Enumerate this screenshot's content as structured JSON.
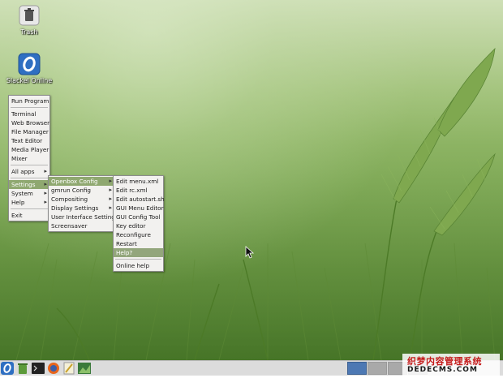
{
  "desktop_icons": [
    {
      "label": "Trash",
      "icon": "trash-icon"
    },
    {
      "label": "Slackel Online",
      "icon": "slackel-online-icon"
    }
  ],
  "root_menu": {
    "items": [
      "Run Program",
      "Terminal",
      "Web Browser",
      "File Manager",
      "Text Editor",
      "Media Player",
      "Mixer",
      "All apps",
      "Settings",
      "System",
      "Help",
      "Exit"
    ],
    "active": "Settings"
  },
  "settings_menu": {
    "items": [
      "Openbox Config",
      "gmrun Config",
      "Compositing",
      "Display Settings",
      "User Interface Settings",
      "Screensaver"
    ],
    "active": "Openbox Config"
  },
  "openbox_menu": {
    "items": [
      "Edit menu.xml",
      "Edit rc.xml",
      "Edit autostart.sh",
      "GUI Menu Editor",
      "GUI Config Tool",
      "Key editor",
      "Reconfigure",
      "Restart",
      "Help?",
      "Online help"
    ],
    "active": "Help?"
  },
  "taskbar": {
    "launchers": [
      "slackel-menu-icon",
      "trash-green-icon",
      "terminal-icon",
      "firefox-icon",
      "text-editor-icon",
      "image-viewer-icon"
    ],
    "workspaces": 4,
    "active_workspace": 1
  },
  "watermark": {
    "line1": "织梦内容管理系统",
    "line2": "DEDECMS.COM"
  },
  "colors": {
    "menu_bg": "#f2f1ef",
    "highlight": "#8fa870",
    "active_workspace": "#4d78b3"
  }
}
